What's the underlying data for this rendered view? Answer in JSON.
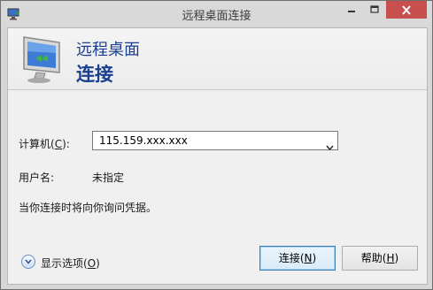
{
  "window": {
    "title": "远程桌面连接",
    "controls": {
      "minimize": "minimize-icon",
      "maximize": "maximize-icon",
      "close": "close-icon"
    }
  },
  "banner": {
    "line1": "远程桌面",
    "line2": "连接"
  },
  "form": {
    "computer_label": "计算机(",
    "computer_label_accel": "C",
    "computer_label_end": "):",
    "computer_value": "115.159.xxx.xxx",
    "user_label": "用户名:",
    "user_value": "未指定",
    "note": "当你连接时将向你询问凭据。"
  },
  "footer": {
    "options_label": "显示选项(",
    "options_accel": "O",
    "options_end": ")",
    "connect_label": "连接(",
    "connect_accel": "N",
    "connect_end": ")",
    "help_label": "帮助(",
    "help_accel": "H",
    "help_end": ")"
  },
  "colors": {
    "accent": "#1a3f8c",
    "close_button": "#c7504f"
  }
}
